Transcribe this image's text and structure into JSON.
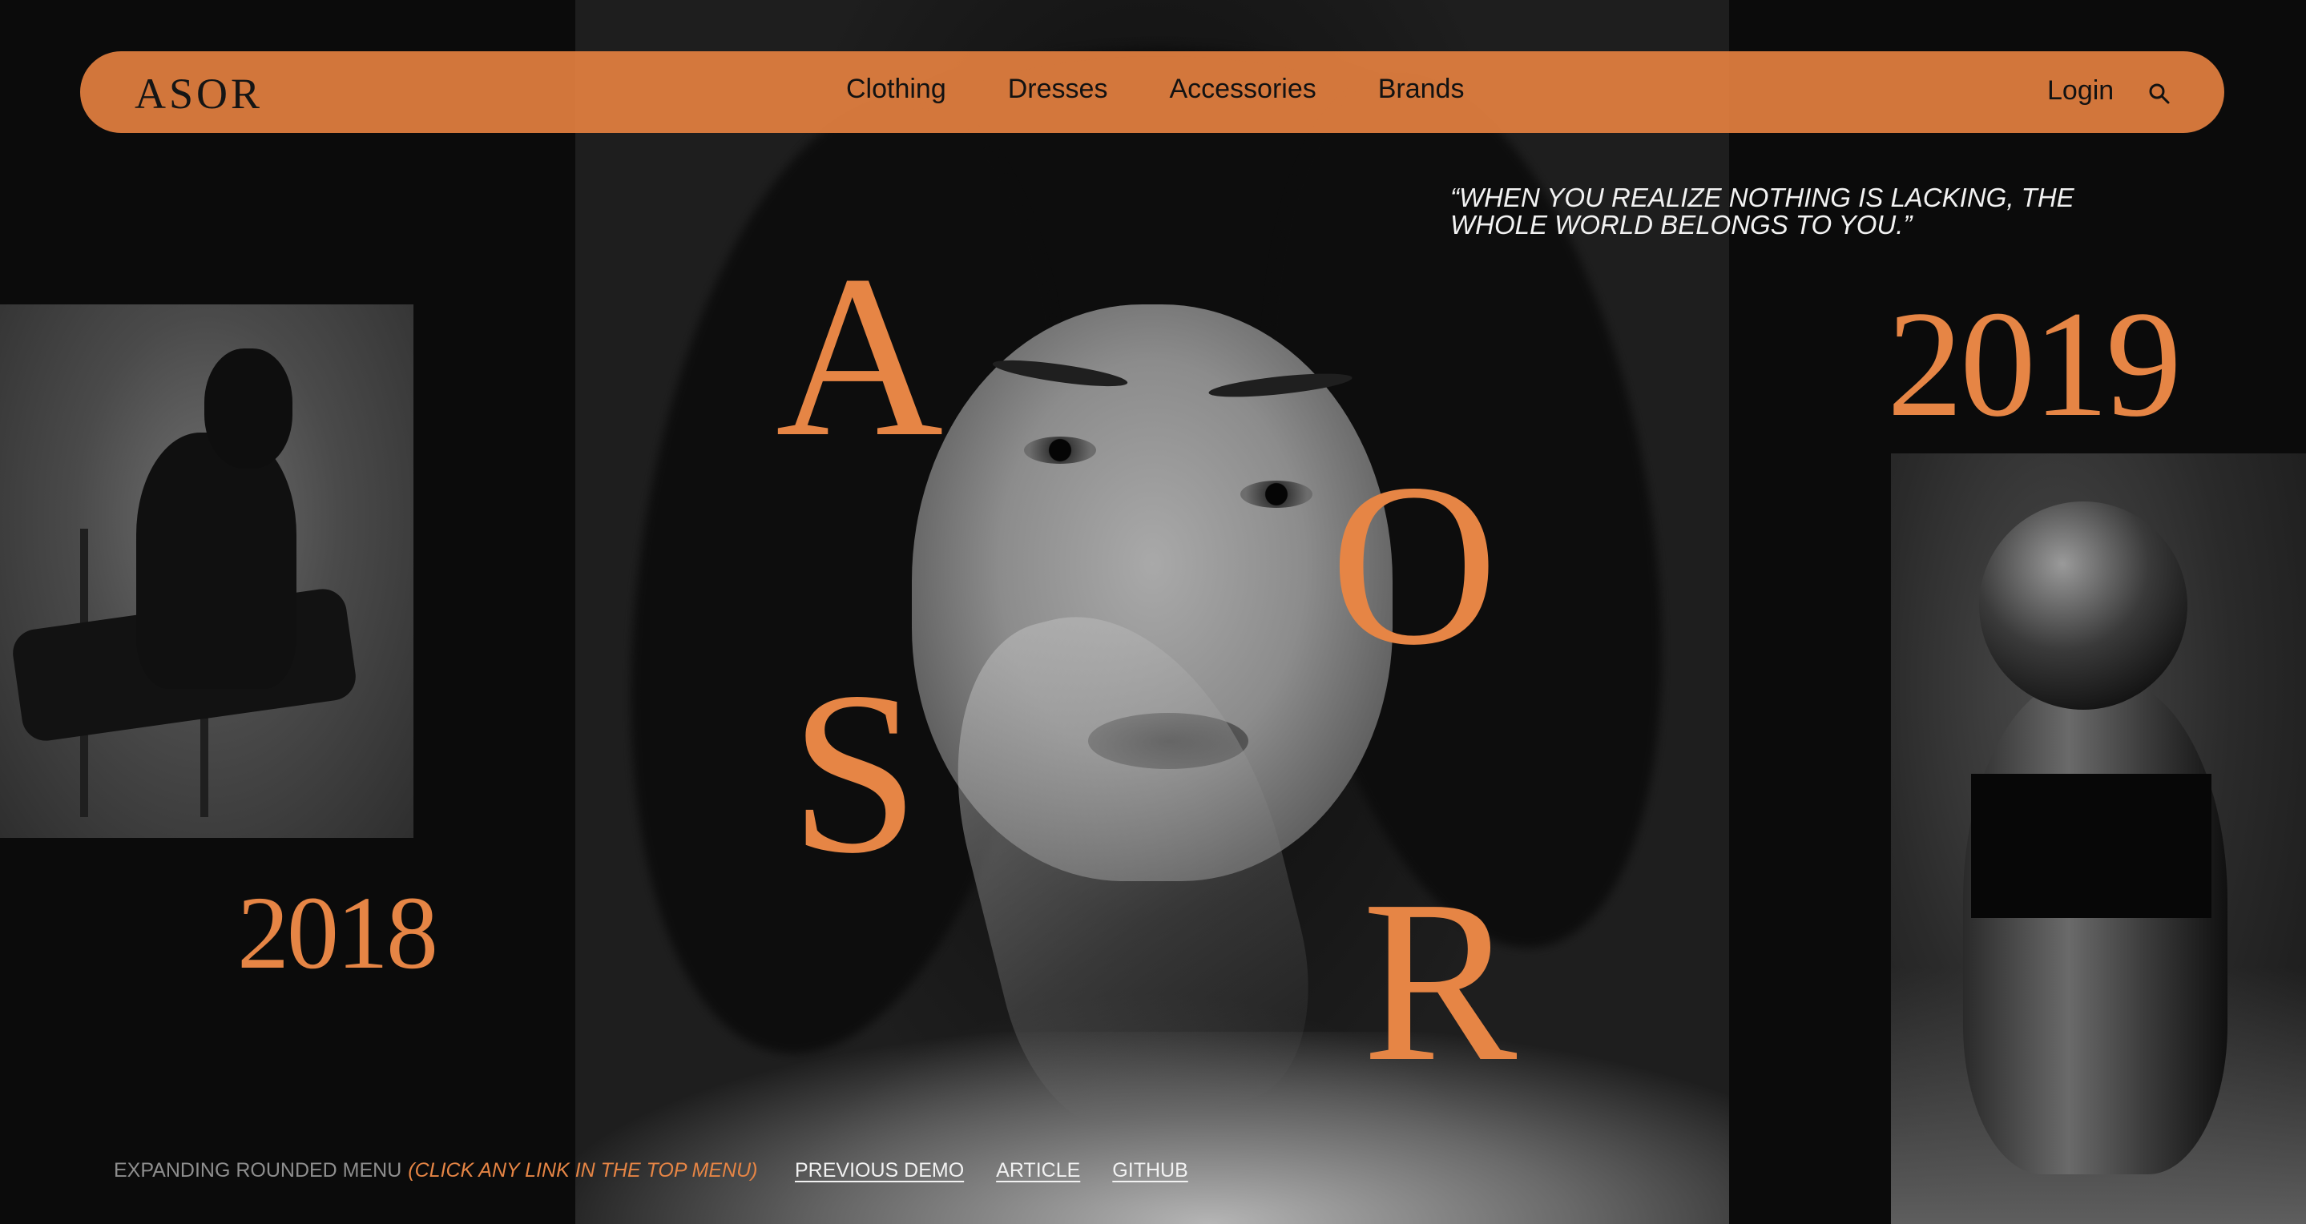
{
  "brand": {
    "logo": "ASOR"
  },
  "nav": {
    "items": [
      {
        "label": "Clothing"
      },
      {
        "label": "Dresses"
      },
      {
        "label": "Accessories"
      },
      {
        "label": "Brands"
      }
    ],
    "login_label": "Login",
    "search_icon": "search-icon"
  },
  "hero": {
    "letters": [
      "A",
      "O",
      "S",
      "R"
    ],
    "quote": "“WHEN YOU REALIZE NOTHING IS LACKING, THE WHOLE WORLD BELONGS TO YOU.”",
    "year_left": "2018",
    "year_right": "2019"
  },
  "footer": {
    "title": "EXPANDING ROUNDED MENU",
    "hint": "(CLICK ANY LINK IN THE TOP MENU)",
    "links": [
      {
        "label": "PREVIOUS DEMO"
      },
      {
        "label": "ARTICLE"
      },
      {
        "label": "GITHUB"
      }
    ]
  },
  "colors": {
    "accent": "#e68545",
    "background": "#0b0b0b",
    "nav_text": "#121212",
    "footer_muted": "#8e8e8e"
  }
}
